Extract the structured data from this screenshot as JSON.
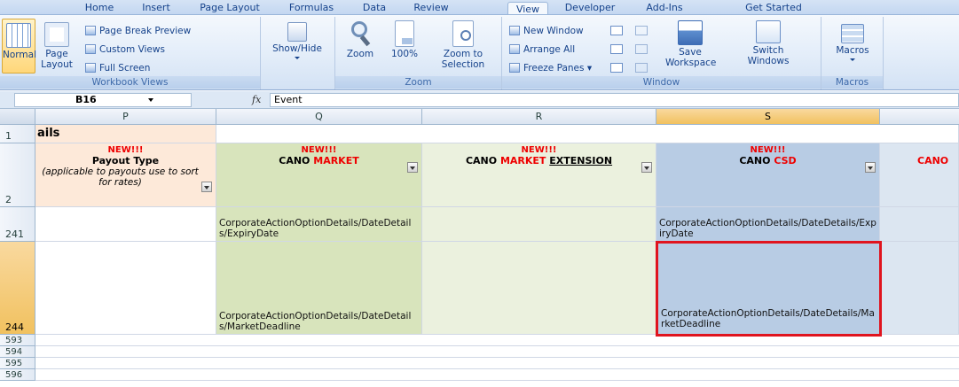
{
  "ribbon": {
    "tabs": [
      "Home",
      "Insert",
      "Page Layout",
      "Formulas",
      "Data",
      "Review",
      "View",
      "Developer",
      "Add-Ins",
      "Get Started"
    ],
    "active_tab": "View",
    "workbook_views": {
      "normal": "Normal",
      "page_layout": "Page Layout",
      "page_break_preview": "Page Break Preview",
      "custom_views": "Custom Views",
      "full_screen": "Full Screen",
      "group_label": "Workbook Views"
    },
    "show_hide": {
      "label": "Show/Hide"
    },
    "zoom": {
      "zoom": "Zoom",
      "hundred": "100%",
      "zoom_to_selection": "Zoom to Selection",
      "group_label": "Zoom"
    },
    "window": {
      "new_window": "New Window",
      "arrange_all": "Arrange All",
      "freeze_panes": "Freeze Panes",
      "save_workspace": "Save Workspace",
      "switch_windows": "Switch Windows",
      "group_label": "Window"
    },
    "macros": {
      "label": "Macros",
      "group_label": "Macros"
    }
  },
  "formula_bar": {
    "cell_ref": "B16",
    "fx": "fx",
    "value": "Event"
  },
  "columns": [
    "P",
    "Q",
    "R",
    "S"
  ],
  "rows": {
    "r1": "1",
    "r2": "2",
    "r241": "241",
    "r244": "244",
    "r593": "593",
    "r594": "594",
    "r595": "595",
    "r596": "596"
  },
  "cells": {
    "p1": "ails",
    "p2_new": "NEW!!!",
    "p2_title": "Payout Type",
    "p2_sub": "(applicable to payouts use to sort for rates)",
    "q2_new": "NEW!!!",
    "q2_a": "CANO",
    "q2_b": "MARKET",
    "r2_new": "NEW!!!",
    "r2_a": "CANO",
    "r2_b": "MARKET",
    "r2_c": "EXTENSION",
    "s2_new": "NEW!!!",
    "s2_a": "CANO",
    "s2_b": "CSD",
    "t2_a": "CANO",
    "q241": "CorporateActionOptionDetails/DateDetails/ExpiryDate",
    "s241": "CorporateActionOptionDetails/DateDetails/ExpiryDate",
    "q244": "CorporateActionOptionDetails/DateDetails/MarketDeadline",
    "s244": "CorporateActionOptionDetails/DateDetails/MarketDeadline"
  },
  "colors": {
    "col_p_header": "#fde9d9",
    "col_q_fill": "#d8e4bc",
    "col_r_fill": "#ebf1de",
    "col_s_fill": "#b8cce4",
    "selection_border": "#e0141e",
    "new_text": "#ee0000"
  }
}
